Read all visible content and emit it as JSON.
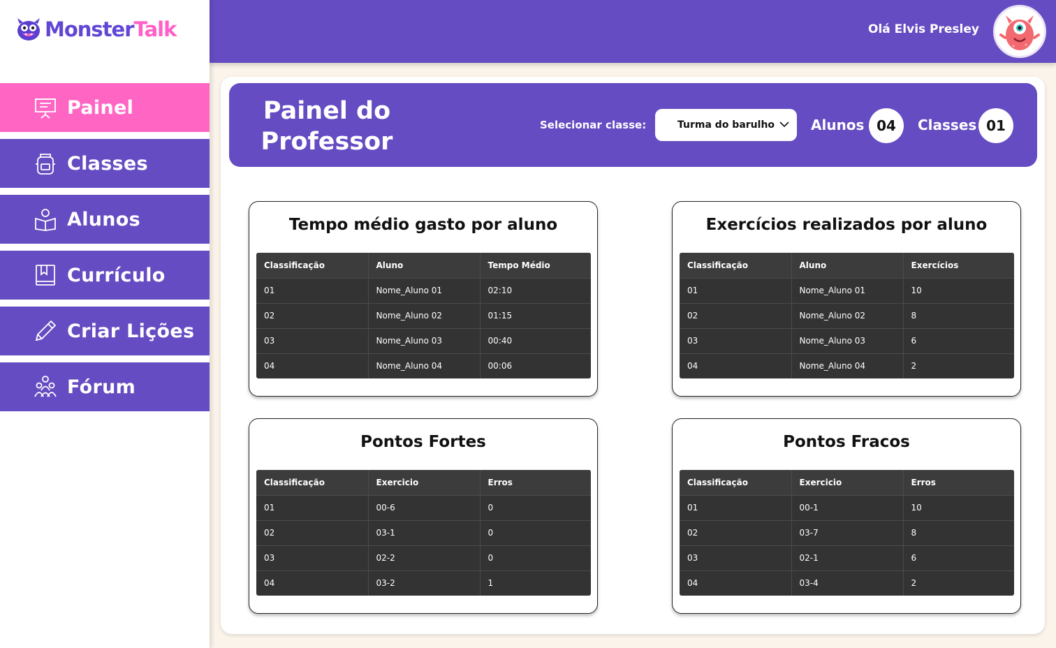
{
  "app": {
    "logo_monster": "Monster",
    "logo_talk": "Talk"
  },
  "sidebar": {
    "items": [
      {
        "label": "Painel",
        "icon": "presentation-board-icon",
        "active": true
      },
      {
        "label": "Classes",
        "icon": "backpack-icon",
        "active": false
      },
      {
        "label": "Alunos",
        "icon": "student-book-icon",
        "active": false
      },
      {
        "label": "Currículo",
        "icon": "bookmark-book-icon",
        "active": false
      },
      {
        "label": "Criar Lições",
        "icon": "pencil-icon",
        "active": false
      },
      {
        "label": "Fórum",
        "icon": "group-people-icon",
        "active": false
      }
    ]
  },
  "header": {
    "greeting": "Olá Elvis Presley"
  },
  "banner": {
    "title": "Painel do Professor",
    "select_label": "Selecionar classe:",
    "selected_class": "Turma do barulho",
    "alunos_label": "Alunos",
    "alunos_count": "04",
    "classes_label": "Classes",
    "classes_count": "01"
  },
  "panels": [
    {
      "title": "Tempo médio gasto por aluno",
      "headers": [
        "Classificação",
        "Aluno",
        "Tempo Médio"
      ],
      "rows": [
        [
          "01",
          "Nome_Aluno 01",
          "02:10"
        ],
        [
          "02",
          "Nome_Aluno 02",
          "01:15"
        ],
        [
          "03",
          "Nome_Aluno 03",
          "00:40"
        ],
        [
          "04",
          "Nome_Aluno 04",
          "00:06"
        ]
      ]
    },
    {
      "title": "Exercícios realizados por aluno",
      "headers": [
        "Classificação",
        "Aluno",
        "Exercícios"
      ],
      "rows": [
        [
          "01",
          "Nome_Aluno 01",
          "10"
        ],
        [
          "02",
          "Nome_Aluno 02",
          "8"
        ],
        [
          "03",
          "Nome_Aluno 03",
          "6"
        ],
        [
          "04",
          "Nome_Aluno 04",
          "2"
        ]
      ]
    },
    {
      "title": "Pontos Fortes",
      "headers": [
        "Classificação",
        "Exercicio",
        "Erros"
      ],
      "rows": [
        [
          "01",
          "00-6",
          "0"
        ],
        [
          "02",
          "03-1",
          "0"
        ],
        [
          "03",
          "02-2",
          "0"
        ],
        [
          "04",
          "03-2",
          "1"
        ]
      ]
    },
    {
      "title": "Pontos Fracos",
      "headers": [
        "Classificação",
        "Exercicio",
        "Erros"
      ],
      "rows": [
        [
          "01",
          "00-1",
          "10"
        ],
        [
          "02",
          "03-7",
          "8"
        ],
        [
          "03",
          "02-1",
          "6"
        ],
        [
          "04",
          "03-4",
          "2"
        ]
      ]
    }
  ],
  "colors": {
    "primary": "#654cc2",
    "active_nav": "#ff66c4",
    "background": "#fbf4ea",
    "table_bg": "#333333"
  }
}
